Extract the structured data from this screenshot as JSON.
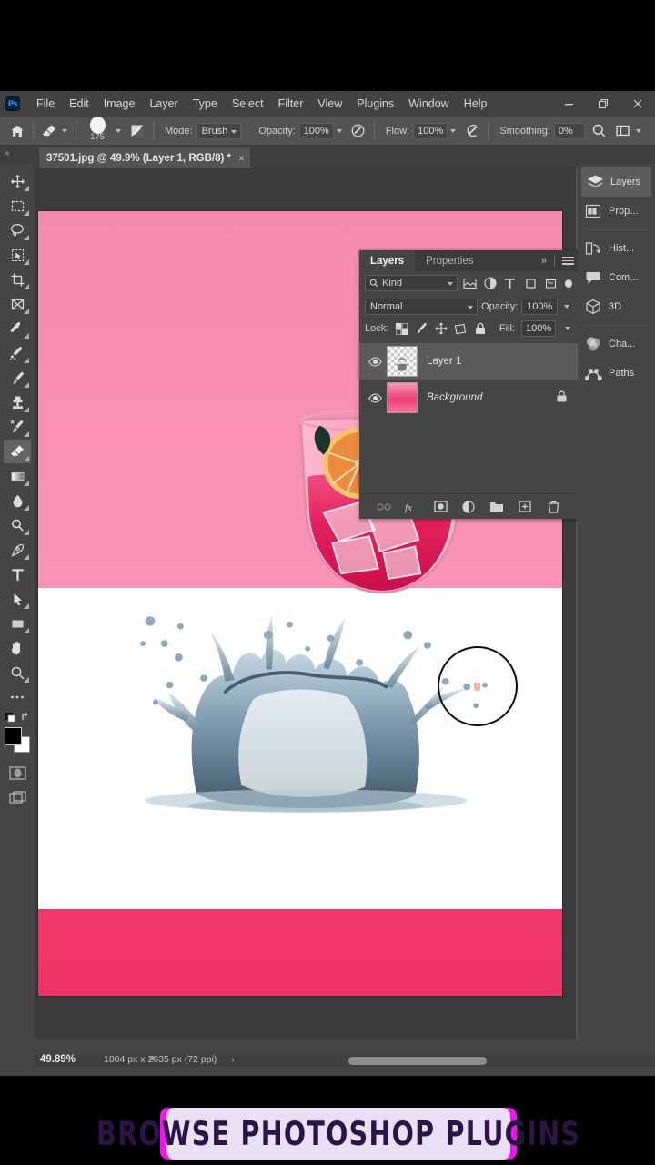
{
  "app": {
    "logo": "ps-logo",
    "menus": [
      "File",
      "Edit",
      "Image",
      "Layer",
      "Type",
      "Select",
      "Filter",
      "View",
      "Plugins",
      "Window",
      "Help"
    ],
    "window_controls": {
      "minimize": "—",
      "restore": "❐",
      "close": "✕"
    }
  },
  "options_bar": {
    "home_icon": "home-icon",
    "tool_preset_icon": "eraser-icon",
    "brush_size": "175",
    "brush_panel_icon": "brush-settings-icon",
    "mode_label": "Mode:",
    "mode_value": "Brush",
    "opacity_label": "Opacity:",
    "opacity_value": "100%",
    "opacity_pressure_icon": "pressure-opacity-icon",
    "flow_label": "Flow:",
    "flow_value": "100%",
    "airbrush_icon": "airbrush-icon",
    "smoothing_label": "Smoothing:",
    "smoothing_value": "0%",
    "search_icon": "search-icon",
    "workspace_icon": "arrange-documents-icon"
  },
  "document": {
    "tab_title": "37501.jpg @ 49.9% (Layer 1, RGB/8) *",
    "close_icon": "×"
  },
  "toolbar": {
    "tools": [
      {
        "name": "move-tool",
        "active": false
      },
      {
        "name": "rectangular-marquee-tool",
        "active": false
      },
      {
        "name": "lasso-tool",
        "active": false
      },
      {
        "name": "object-selection-tool",
        "active": false
      },
      {
        "name": "crop-tool",
        "active": false
      },
      {
        "name": "frame-tool",
        "active": false
      },
      {
        "name": "eyedropper-tool",
        "active": false
      },
      {
        "name": "spot-healing-brush-tool",
        "active": false
      },
      {
        "name": "brush-tool",
        "active": false
      },
      {
        "name": "clone-stamp-tool",
        "active": false
      },
      {
        "name": "history-brush-tool",
        "active": false
      },
      {
        "name": "eraser-tool",
        "active": true
      },
      {
        "name": "gradient-tool",
        "active": false
      },
      {
        "name": "blur-tool",
        "active": false
      },
      {
        "name": "dodge-tool",
        "active": false
      },
      {
        "name": "pen-tool",
        "active": false
      },
      {
        "name": "type-tool",
        "active": false
      },
      {
        "name": "path-selection-tool",
        "active": false
      },
      {
        "name": "rectangle-tool",
        "active": false
      },
      {
        "name": "hand-tool",
        "active": false
      },
      {
        "name": "zoom-tool",
        "active": false
      },
      {
        "name": "edit-toolbar-tool",
        "active": false
      }
    ],
    "foreground_color": "#000000",
    "background_color": "#ffffff",
    "quick-mask": "quick-mask-icon",
    "screen-mode": "screen-mode-icon"
  },
  "layers_panel": {
    "tabs": [
      {
        "label": "Layers",
        "active": true
      },
      {
        "label": "Properties",
        "active": false
      }
    ],
    "collapse_icon": "»",
    "menu_icon": "panel-menu-icon",
    "filter": {
      "kind_label": "Kind",
      "icons": [
        "filter-pixel-icon",
        "filter-adjustment-icon",
        "filter-type-icon",
        "filter-shape-icon",
        "filter-smart-object-icon"
      ],
      "toggle": "filter-toggle"
    },
    "blend_mode": "Normal",
    "opacity_label": "Opacity:",
    "opacity_value": "100%",
    "lock_label": "Lock:",
    "lock_icons": [
      "lock-transparent-pixels-icon",
      "lock-image-pixels-icon",
      "lock-position-icon",
      "lock-artboard-nesting-icon",
      "lock-all-icon"
    ],
    "fill_label": "Fill:",
    "fill_value": "100%",
    "layers": [
      {
        "name": "Layer 1",
        "visible": true,
        "selected": true,
        "locked": false,
        "italic": false,
        "thumb": "checker"
      },
      {
        "name": "Background",
        "visible": true,
        "selected": false,
        "locked": true,
        "italic": true,
        "thumb": "pink"
      }
    ],
    "bottom_icons": [
      {
        "name": "link-layers-icon",
        "glyph": "⚭",
        "dim": true
      },
      {
        "name": "layer-style-fx-icon",
        "glyph": "fx",
        "dim": false
      },
      {
        "name": "add-layer-mask-icon",
        "glyph": "▣",
        "dim": false
      },
      {
        "name": "new-adjustment-layer-icon",
        "glyph": "◐",
        "dim": false
      },
      {
        "name": "new-group-icon",
        "glyph": "Ὄ1",
        "dim": false
      },
      {
        "name": "new-layer-icon",
        "glyph": "⊞",
        "dim": false
      },
      {
        "name": "delete-layer-icon",
        "glyph": "Ὕ1",
        "dim": false
      }
    ]
  },
  "dock": {
    "items": [
      {
        "label": "Layers",
        "icon": "layers-icon",
        "active": true,
        "sep_after": false
      },
      {
        "label": "Prop...",
        "icon": "properties-icon",
        "active": false,
        "sep_after": true
      },
      {
        "label": "Hist...",
        "icon": "history-icon",
        "active": false,
        "sep_after": false
      },
      {
        "label": "Com...",
        "icon": "comments-icon",
        "active": false,
        "sep_after": false
      },
      {
        "label": "3D",
        "icon": "3d-icon",
        "active": false,
        "sep_after": true
      },
      {
        "label": "Cha...",
        "icon": "channels-icon",
        "active": false,
        "sep_after": false
      },
      {
        "label": "Paths",
        "icon": "paths-icon",
        "active": false,
        "sep_after": false
      }
    ]
  },
  "status_bar": {
    "zoom": "49.89%",
    "dimensions": "1804 px x 2635 px (72 ppi)",
    "chevron": "›"
  },
  "canvas": {
    "pink_top_color": "#f68fb3",
    "white_color": "#fefeff",
    "pink_bottom_color": "#ef3368",
    "brush_cursor": "brush-cursor-ring"
  },
  "banner": {
    "text": "BROWSE PHOTOSHOP PLUGINS",
    "bg_color": "#e9e0f5",
    "edge_color": "#f312f3",
    "text_color": "#2c1447"
  }
}
